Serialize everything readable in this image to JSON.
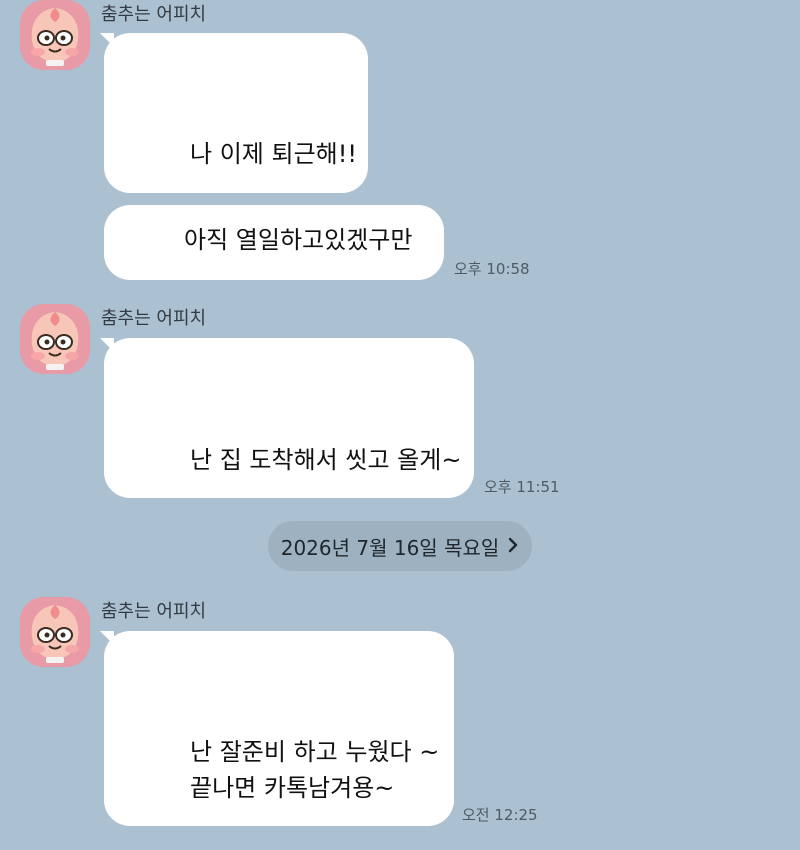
{
  "sender_name": "춤추는 어피치",
  "messages": [
    {
      "text": "나 이제 퇴근해!!"
    },
    {
      "text": "아직 열일하고있겠구만",
      "time": "오후 10:58"
    },
    {
      "text": "난 집 도착해서 씻고 올게~",
      "time": "오후 11:51"
    },
    {
      "lines": [
        "난 잘준비 하고 누웠다 ~",
        "끝나면 카톡남겨용~"
      ],
      "time": "오전 12:25"
    }
  ],
  "date_divider": {
    "label": "2026년 7월 16일 목요일",
    "icon": "chevron-right-icon"
  },
  "colors": {
    "background": "#abc1d1",
    "bubble": "#ffffff",
    "avatar": "#e89aa6",
    "date_pill": "#9db1c1"
  }
}
